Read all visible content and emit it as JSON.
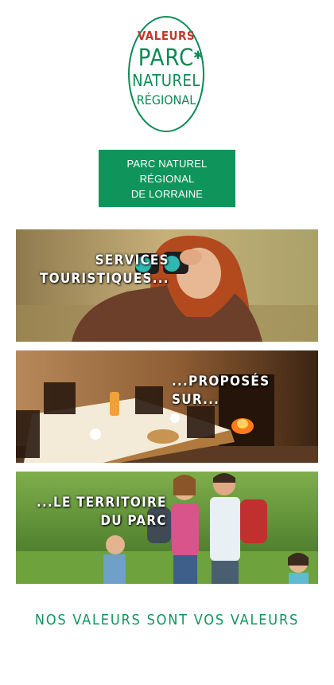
{
  "logo": {
    "line1": "VALEURS",
    "line2": "PARC",
    "line3": "NATUREL",
    "line4": "RÉGIONAL",
    "star_icon": "asterisk-icon",
    "colors": {
      "red": "#c0392b",
      "green": "#0c8a55"
    }
  },
  "title_box": {
    "line1": "PARC NATUREL RÉGIONAL",
    "line2": "DE LORRAINE",
    "background": "#0f955c"
  },
  "panels": [
    {
      "caption_line1": "SERVICES",
      "caption_line2": "TOURISTIQUES...",
      "image": "woman-with-binoculars-photo"
    },
    {
      "caption_line1": "...PROPOSÉS SUR...",
      "image": "rustic-dining-room-photo"
    },
    {
      "caption_line1": "...LE TERRITOIRE",
      "caption_line2": "DU PARC",
      "image": "family-hiking-photo"
    }
  ],
  "tagline": "NOS VALEURS SONT VOS VALEURS"
}
